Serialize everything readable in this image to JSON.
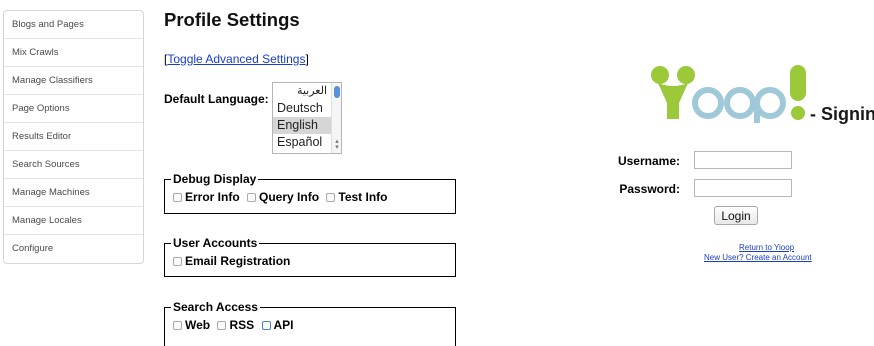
{
  "sidebar": {
    "items": [
      {
        "label": "Blogs and Pages"
      },
      {
        "label": "Mix Crawls"
      },
      {
        "label": "Manage Classifiers"
      },
      {
        "label": "Page Options"
      },
      {
        "label": "Results Editor"
      },
      {
        "label": "Search Sources"
      },
      {
        "label": "Manage Machines"
      },
      {
        "label": "Manage Locales"
      },
      {
        "label": "Configure"
      }
    ]
  },
  "main": {
    "title": "Profile Settings",
    "toggle_open": "[",
    "toggle_link": "Toggle Advanced Settings",
    "toggle_close": "]",
    "language": {
      "label": "Default Language:",
      "options": [
        "العربية",
        "Deutsch",
        "English",
        "Español"
      ],
      "selected": "English"
    },
    "debug": {
      "legend": "Debug Display",
      "options": [
        "Error Info",
        "Query Info",
        "Test Info"
      ]
    },
    "accounts": {
      "legend": "User Accounts",
      "options": [
        "Email Registration"
      ]
    },
    "search_access": {
      "legend": "Search Access",
      "options": [
        "Web",
        "RSS",
        "API"
      ]
    }
  },
  "signin": {
    "title": "- Signin",
    "username_label": "Username:",
    "password_label": "Password:",
    "login_button": "Login",
    "return_link": "Return to Yioop",
    "new_user_link": "New User? Create an Account"
  },
  "colors": {
    "link": "#1a3ec4",
    "logo_green": "#9bc93a",
    "logo_blue": "#9fc9d8"
  }
}
